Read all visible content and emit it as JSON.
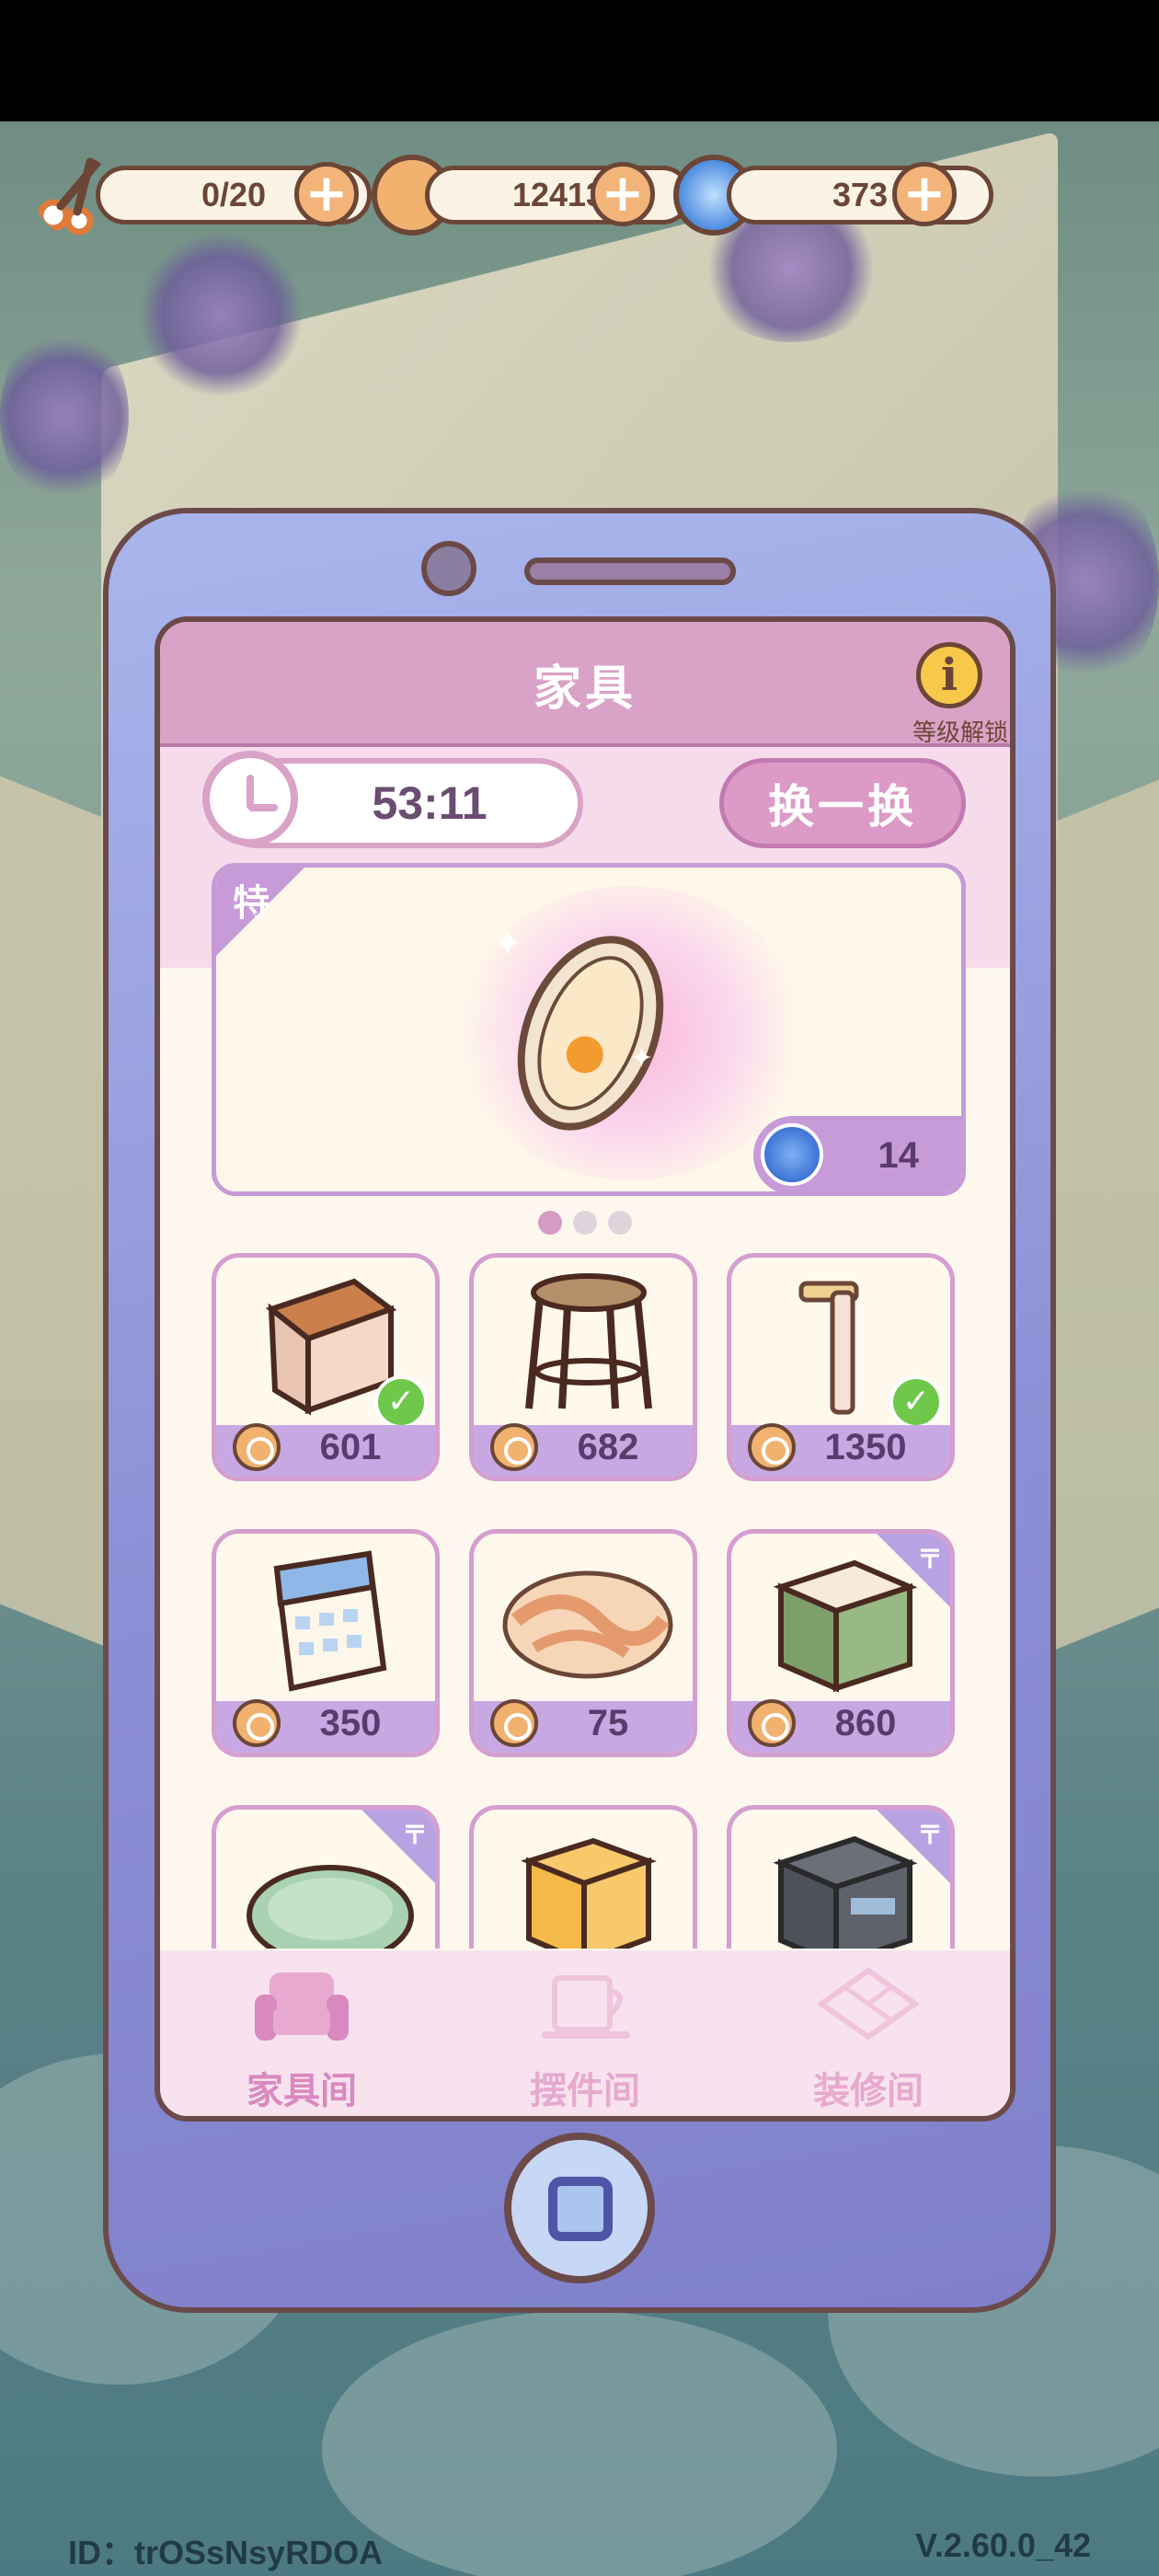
{
  "resources": {
    "scissors": {
      "value": "0/20",
      "icon": "scissors-icon"
    },
    "coins": {
      "value": "12413",
      "icon": "coin-icon"
    },
    "gems": {
      "value": "373",
      "icon": "swirl-gem-icon"
    },
    "plus": "+"
  },
  "panel": {
    "title": "家具",
    "info_icon": "i",
    "info_label": "等级解锁",
    "timer": "53:11",
    "swap_label": "换一换"
  },
  "featured": {
    "tag": "特",
    "item_icon": "oval-mirror",
    "price": "14",
    "currency_icon": "swirl-gem-icon",
    "pages": 3,
    "active_page": 1
  },
  "items": [
    {
      "name": "wooden-table",
      "price": "601",
      "owned": true,
      "ribbon": false
    },
    {
      "name": "round-stool",
      "price": "682",
      "owned": false,
      "ribbon": false
    },
    {
      "name": "wall-lamp",
      "price": "1350",
      "owned": true,
      "ribbon": false
    },
    {
      "name": "wall-calendar",
      "price": "350",
      "owned": false,
      "ribbon": false
    },
    {
      "name": "oval-rug",
      "price": "75",
      "owned": false,
      "ribbon": false
    },
    {
      "name": "green-nightstand",
      "price": "860",
      "owned": false,
      "ribbon": true
    },
    {
      "name": "green-round-cushion",
      "price": "",
      "owned": false,
      "ribbon": true
    },
    {
      "name": "cat-cube-seat",
      "price": "",
      "owned": true,
      "ribbon": false
    },
    {
      "name": "gray-nightstand",
      "price": "",
      "owned": true,
      "ribbon": true
    }
  ],
  "tabs": [
    {
      "label": "家具间",
      "icon": "armchair-icon",
      "active": true
    },
    {
      "label": "摆件间",
      "icon": "cup-icon",
      "active": false
    },
    {
      "label": "装修间",
      "icon": "floor-tile-icon",
      "active": false
    }
  ],
  "footer": {
    "id": "ID：trOSsNsyRDOA",
    "version": "V.2.60.0_42"
  },
  "colors": {
    "phone": "#8d8fd6",
    "panel_header": "#d9a2c7",
    "card_border": "#d49fd0",
    "price_bar": "#c8a8e3",
    "outline": "#6b4637"
  }
}
